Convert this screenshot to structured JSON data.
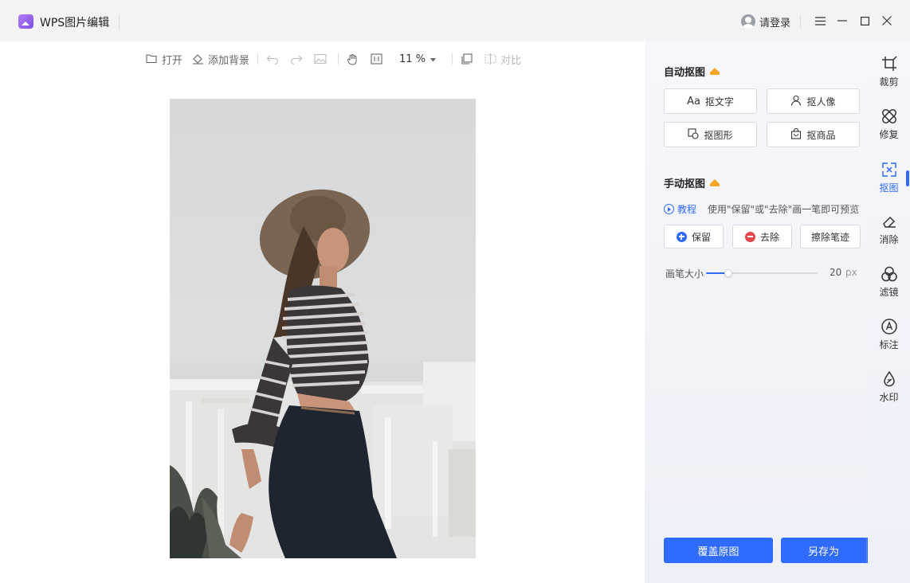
{
  "titlebar": {
    "app_title": "WPS图片编辑",
    "login_label": "请登录",
    "menu_icon": "menu-icon",
    "minimize_icon": "minimize-icon",
    "maximize_icon": "maximize-icon",
    "close_icon": "close-icon"
  },
  "toolbar": {
    "open_label": "打开",
    "add_bg_label": "添加背景",
    "zoom_value": "11 %",
    "compare_label": "对比"
  },
  "panel": {
    "auto_title": "自动抠图",
    "auto_buttons": [
      {
        "label": "抠文字",
        "icon": "Aa"
      },
      {
        "label": "抠人像",
        "icon": "person-icon"
      },
      {
        "label": "抠图形",
        "icon": "shape-icon"
      },
      {
        "label": "抠商品",
        "icon": "bag-icon"
      }
    ],
    "manual_title": "手动抠图",
    "tutorial_label": "教程",
    "tutorial_hint": "使用\"保留\"或\"去除\"画一笔即可预览",
    "keep_label": "保留",
    "remove_label": "去除",
    "erase_label": "擦除笔迹",
    "brush_label": "画笔大小",
    "brush_value": "20",
    "brush_unit": "px",
    "brush_level": 0.2,
    "cover_label": "覆盖原图",
    "save_as_label": "另存为"
  },
  "rail": [
    {
      "label": "裁剪",
      "icon": "crop-icon"
    },
    {
      "label": "修复",
      "icon": "bandage-icon"
    },
    {
      "label": "抠图",
      "icon": "cutout-icon",
      "active": true
    },
    {
      "label": "消除",
      "icon": "eraser-icon"
    },
    {
      "label": "滤镜",
      "icon": "filter-icon"
    },
    {
      "label": "标注",
      "icon": "annotate-icon"
    },
    {
      "label": "水印",
      "icon": "watermark-icon"
    }
  ],
  "colors": {
    "accent": "#2f6bff",
    "crown": "#f5a623",
    "remove_red": "#e5484d"
  }
}
